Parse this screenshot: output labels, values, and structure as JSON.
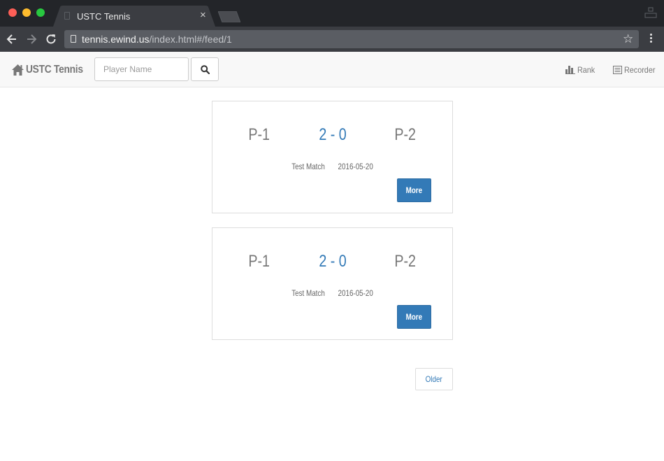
{
  "browser": {
    "tab_title": "USTC Tennis",
    "tab_close": "×",
    "url_host": "tennis.ewind.us",
    "url_path": "/index.html#/feed/1",
    "star": "☆"
  },
  "navbar": {
    "brand": "USTC Tennis",
    "brand_icon": "home-icon",
    "search_placeholder": "Player Name",
    "search_icon": "search-icon",
    "links": [
      {
        "label": "Rank",
        "icon": "bar-chart-icon"
      },
      {
        "label": "Recorder",
        "icon": "list-alt-icon"
      }
    ]
  },
  "feed": {
    "matches": [
      {
        "player1": "P-1",
        "score": "2 - 0",
        "player2": "P-2",
        "title": "Test Match",
        "date": "2016-05-20",
        "more_label": "More"
      },
      {
        "player1": "P-1",
        "score": "2 - 0",
        "player2": "P-2",
        "title": "Test Match",
        "date": "2016-05-20",
        "more_label": "More"
      }
    ],
    "older_label": "Older"
  },
  "colors": {
    "accent": "#337ab7",
    "muted_text": "#777777",
    "navbar_bg": "#f8f8f8"
  }
}
